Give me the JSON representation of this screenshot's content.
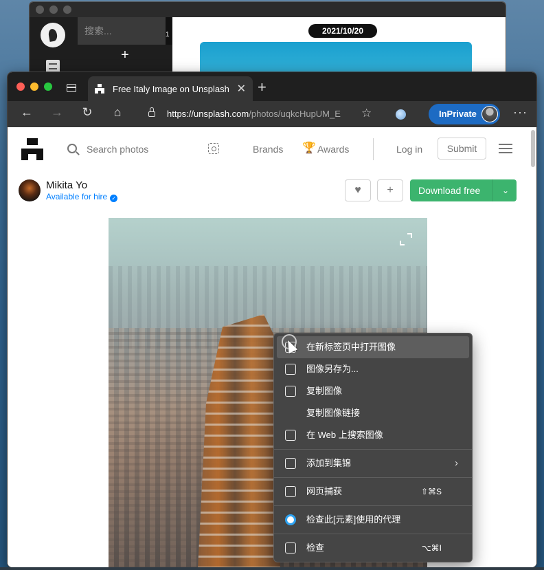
{
  "bg_window": {
    "search_placeholder": "搜索...",
    "count": "1",
    "add_label": "+",
    "date_pill": "2021/10/20"
  },
  "browser": {
    "tab_title": "Free Italy Image on Unsplash",
    "tab_close": "✕",
    "new_tab": "+",
    "url_main": "https://unsplash.com",
    "url_rest": "/photos/uqkcHupUM_E",
    "inprivate_label": "InPrivate",
    "more": "···"
  },
  "page": {
    "search_placeholder": "Search photos",
    "nav": {
      "brands": "Brands",
      "awards": "Awards",
      "login": "Log in",
      "submit": "Submit"
    },
    "author": {
      "name": "Mikita Yo",
      "hire": "Available for hire"
    },
    "actions": {
      "like": "♥",
      "add": "+",
      "download": "Download free",
      "download_menu": "⌄"
    }
  },
  "context_menu": {
    "items": [
      {
        "label": "在新标签页中打开图像",
        "icon": "open-new-tab-icon"
      },
      {
        "label": "图像另存为...",
        "icon": "save-image-icon"
      },
      {
        "label": "复制图像",
        "icon": "copy-image-icon"
      },
      {
        "label": "复制图像链接",
        "icon": ""
      },
      {
        "label": "在 Web 上搜索图像",
        "icon": "visual-search-icon"
      },
      {
        "label": "添加到集锦",
        "icon": "collections-icon",
        "submenu": "›"
      },
      {
        "label": "网页捕获",
        "icon": "web-capture-icon",
        "shortcut": "⇧⌘S"
      },
      {
        "label": "检查此[元素]使用的代理",
        "icon": "proxy-inspector-icon"
      },
      {
        "label": "检查",
        "icon": "inspect-icon",
        "shortcut": "⌥⌘I"
      }
    ]
  }
}
